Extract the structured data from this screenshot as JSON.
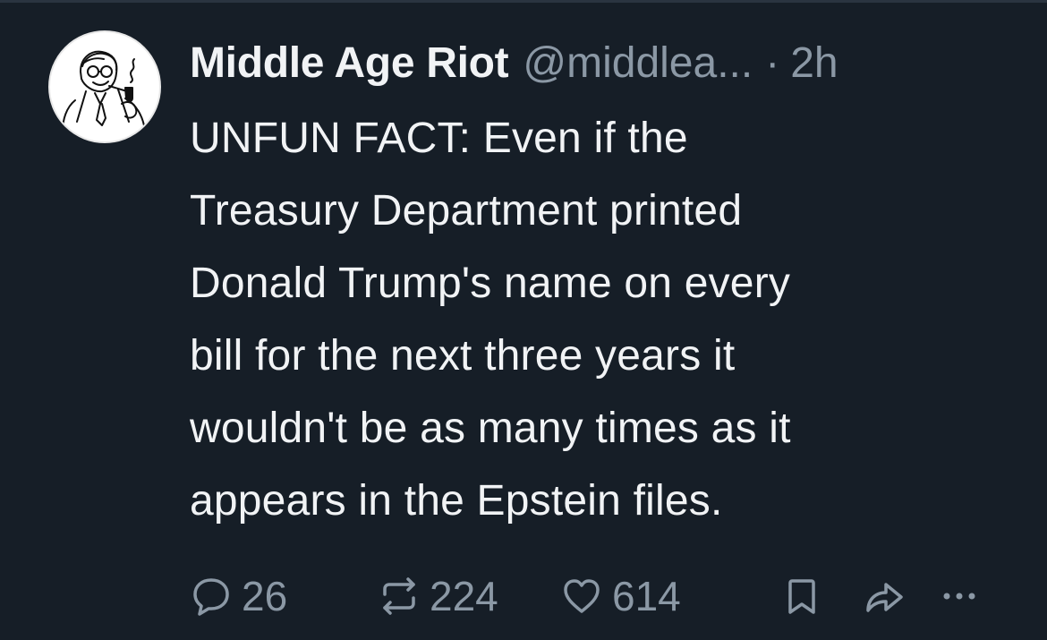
{
  "post": {
    "display_name": "Middle Age Riot",
    "handle": "@middlea...",
    "separator": "·",
    "time": "2h",
    "text_lines": [
      "UNFUN FACT: Even if the",
      "Treasury Department printed",
      "Donald Trump's name on every",
      "bill for the next three years it",
      "wouldn't be as many times as it",
      "appears in the Epstein files."
    ]
  },
  "actions": {
    "replies": "26",
    "reposts": "224",
    "likes": "614",
    "more": "···"
  },
  "icons": {
    "reply": "speech-bubble-icon",
    "repost": "repost-arrows-icon",
    "like": "heart-icon",
    "bookmark": "bookmark-icon",
    "share": "share-arrow-icon",
    "more": "ellipsis-icon"
  },
  "colors": {
    "background": "#161e27",
    "text": "#f1f3f5",
    "muted": "#8b98a5"
  }
}
